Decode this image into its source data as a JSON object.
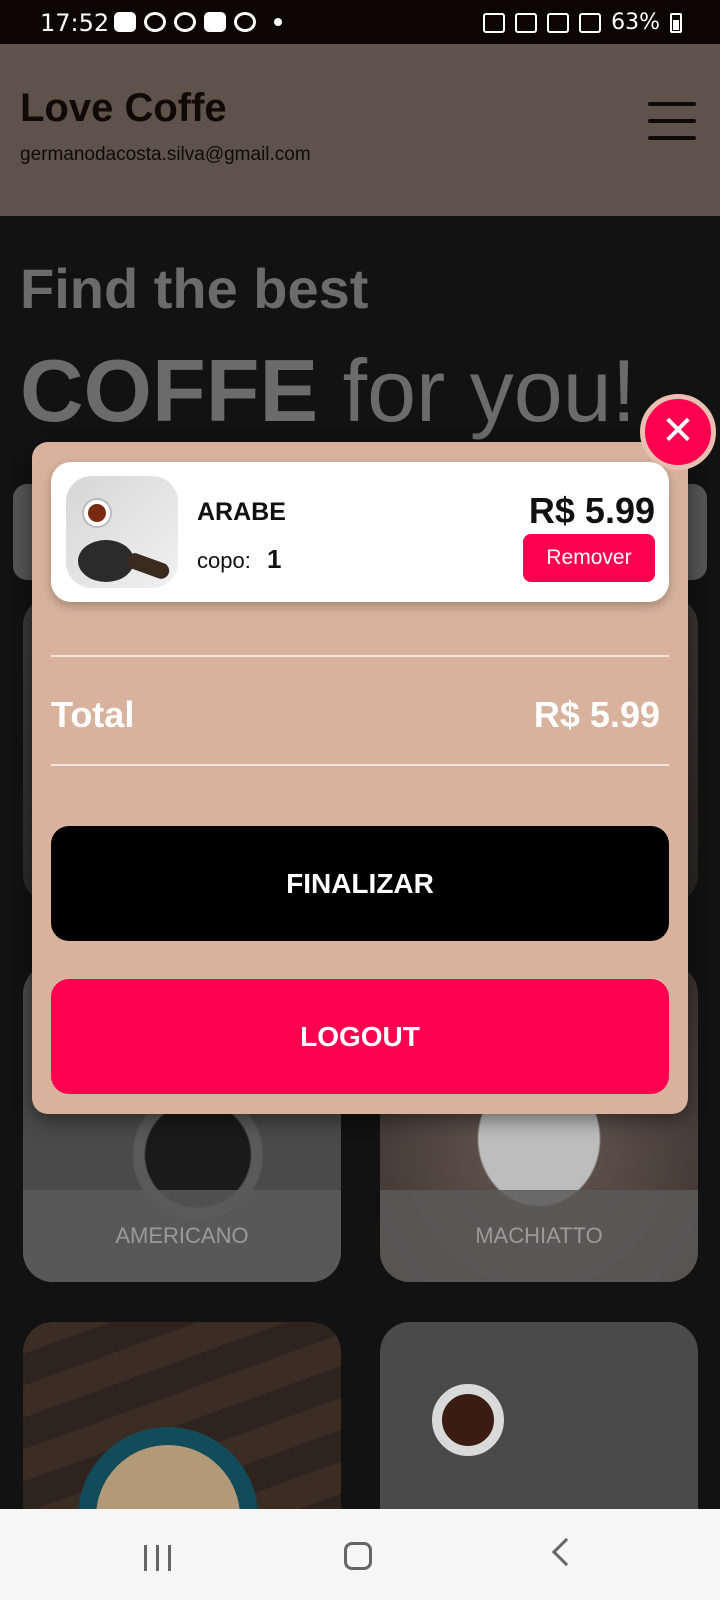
{
  "status_bar": {
    "time": "17:52",
    "battery": "63%"
  },
  "header": {
    "app_title": "Love Coffe",
    "email": "germanodacosta.silva@gmail.com"
  },
  "hero": {
    "line1": "Find the best",
    "line2_bold": "COFFE",
    "line2_rest": " for you!"
  },
  "products": [
    {
      "name": "AMERICANO"
    },
    {
      "name": "MACHIATTO"
    }
  ],
  "cart": {
    "items": [
      {
        "name": "ARABE",
        "qty_label": "copo:",
        "qty": "1",
        "price": "R$ 5.99",
        "remove_label": "Remover"
      }
    ],
    "total_label": "Total",
    "total_value": "R$ 5.99",
    "finalize_label": "FINALIZAR",
    "logout_label": "LOGOUT"
  },
  "colors": {
    "accent": "#ff0050",
    "modal_bg": "#d8b29c",
    "header_bg": "#5f524a"
  }
}
